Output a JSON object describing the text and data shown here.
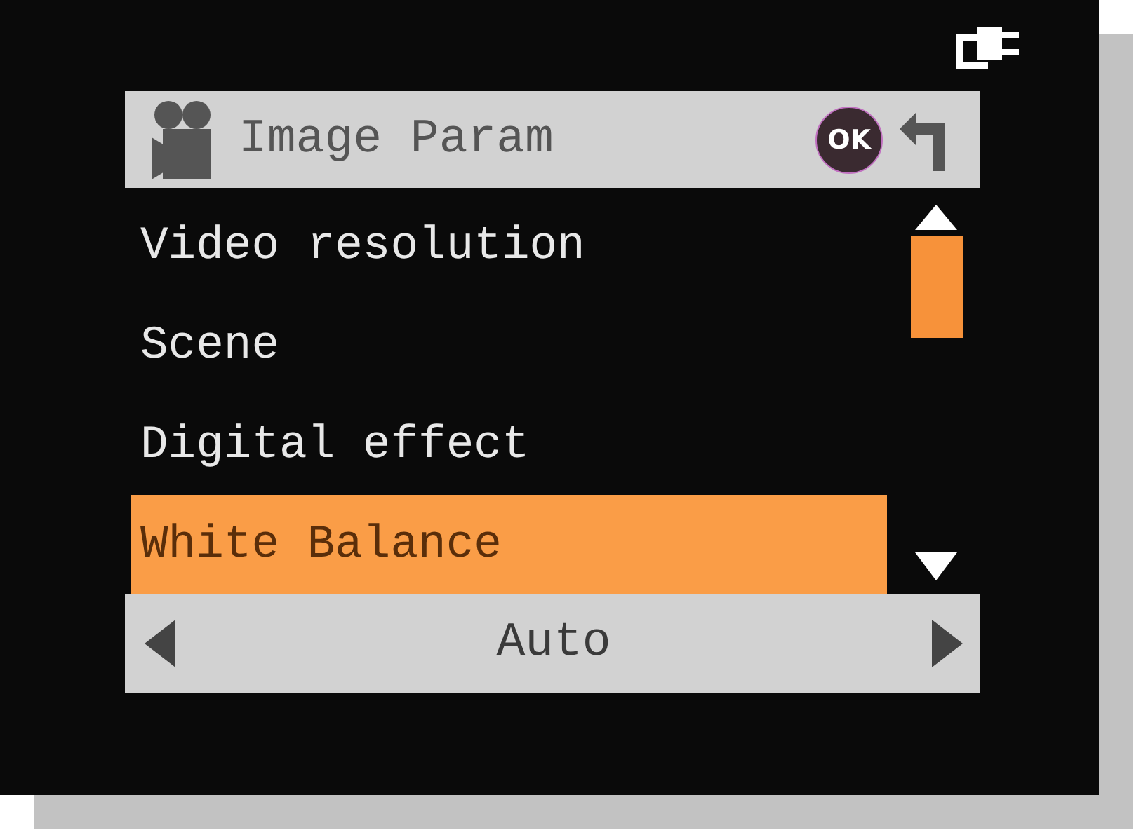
{
  "header": {
    "title": "Image Param",
    "ok_label": "OK"
  },
  "items": [
    {
      "label": "Video resolution",
      "selected": false
    },
    {
      "label": "Scene",
      "selected": false
    },
    {
      "label": "Digital effect",
      "selected": false
    },
    {
      "label": "White Balance",
      "selected": true
    }
  ],
  "value": {
    "text": "Auto"
  }
}
